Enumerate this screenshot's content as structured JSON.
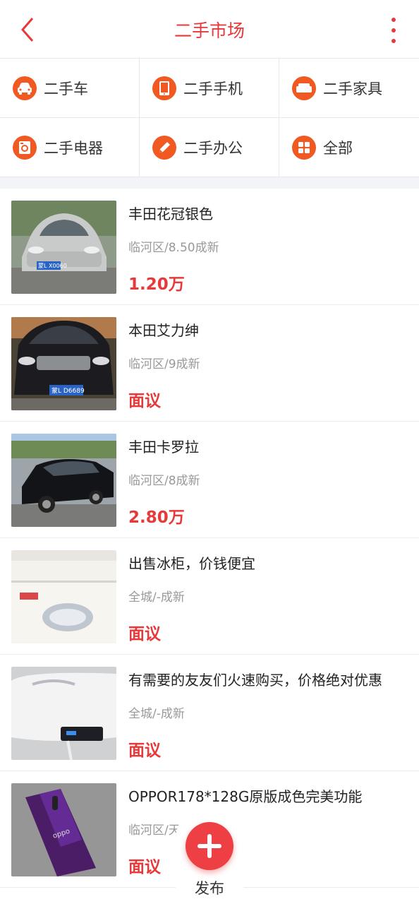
{
  "header": {
    "title": "二手市场"
  },
  "categories": [
    {
      "label": "二手车",
      "icon": "car-icon"
    },
    {
      "label": "二手手机",
      "icon": "phone-icon"
    },
    {
      "label": "二手家具",
      "icon": "sofa-icon"
    },
    {
      "label": "二手电器",
      "icon": "washer-icon"
    },
    {
      "label": "二手办公",
      "icon": "pencil-icon"
    },
    {
      "label": "全部",
      "icon": "grid-icon"
    }
  ],
  "items": [
    {
      "name": "丰田花冠银色",
      "meta": "临河区/8.50成新",
      "price": "1.20万",
      "plate": "蒙L X0060"
    },
    {
      "name": "本田艾力绅",
      "meta": "临河区/9成新",
      "price": "面议",
      "plate": "蒙L D6689"
    },
    {
      "name": "丰田卡罗拉",
      "meta": "临河区/8成新",
      "price": "2.80万"
    },
    {
      "name": "出售冰柜，价钱便宜",
      "meta": "全城/-成新",
      "price": "面议"
    },
    {
      "name": "有需要的友友们火速购买，价格绝对优惠",
      "meta": "全城/-成新",
      "price": "面议"
    },
    {
      "name": "OPPOR178*128G原版成色完美功能",
      "meta": "临河区/天",
      "price": "面议",
      "brand": "oppo"
    }
  ],
  "fab": {
    "label": "发布"
  },
  "colors": {
    "accent": "#e8393a",
    "category_icon": "#f05a22"
  }
}
